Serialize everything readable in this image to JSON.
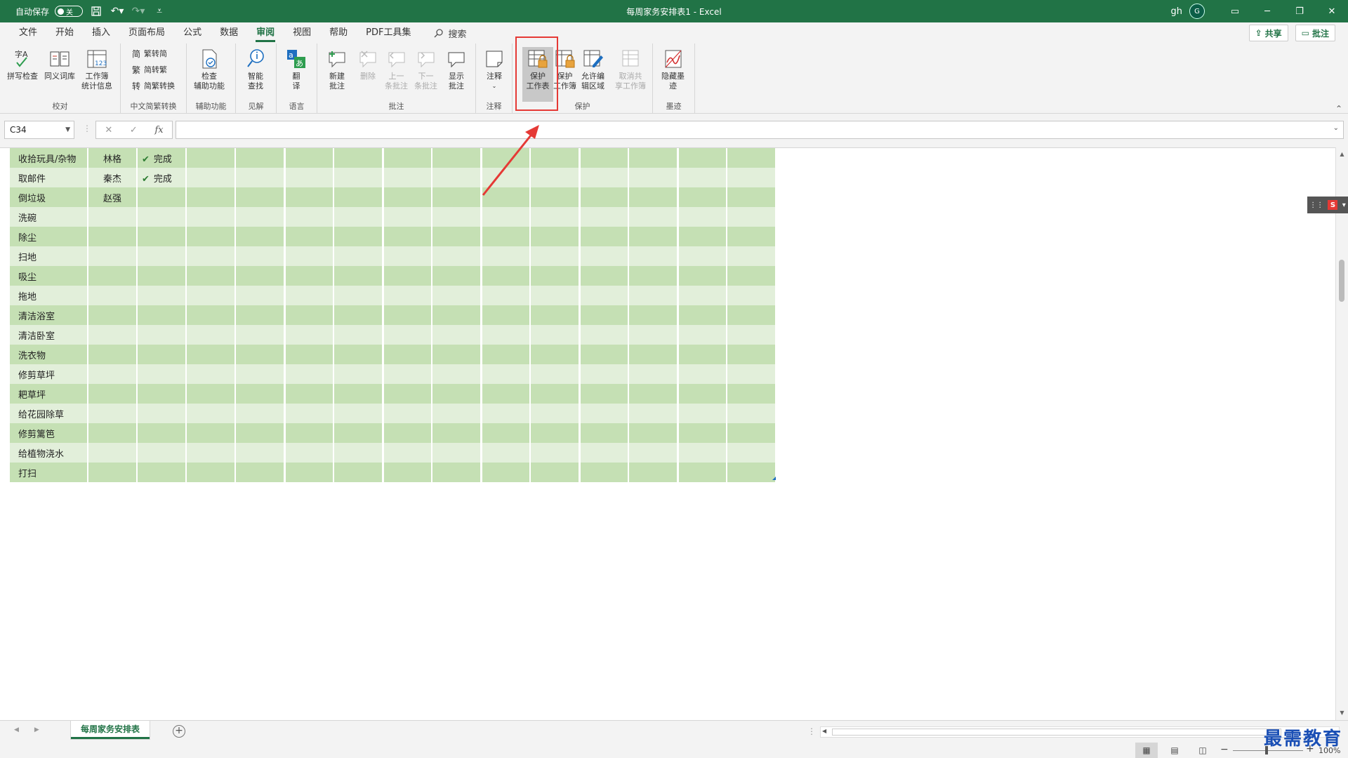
{
  "titlebar": {
    "autosave_label": "自动保存",
    "autosave_state": "关",
    "title": "每周家务安排表1  -  Excel",
    "user": "gh",
    "avatar_initial": "G"
  },
  "menu": {
    "items": [
      "文件",
      "开始",
      "插入",
      "页面布局",
      "公式",
      "数据",
      "审阅",
      "视图",
      "帮助",
      "PDF工具集"
    ],
    "active": "审阅",
    "search": "搜索",
    "share": "共享",
    "comments": "批注"
  },
  "ribbon": {
    "proofing": {
      "label": "校对",
      "spell": "拼写检查",
      "thesaurus": "同义词库",
      "stats_1": "工作簿",
      "stats_2": "统计信息"
    },
    "chinese": {
      "label": "中文简繁转换",
      "t2s": "繁转简",
      "s2t": "简转繁",
      "convert": "简繁转换"
    },
    "accessibility": {
      "label": "辅助功能",
      "check_1": "检查",
      "check_2": "辅助功能"
    },
    "insights": {
      "label": "见解",
      "smart_1": "智能",
      "smart_2": "查找"
    },
    "language": {
      "label": "语言",
      "translate_1": "翻",
      "translate_2": "译"
    },
    "comments": {
      "label": "批注",
      "new_1": "新建",
      "new_2": "批注",
      "delete": "删除",
      "prev_1": "上一",
      "prev_2": "条批注",
      "next_1": "下一",
      "next_2": "条批注",
      "show_1": "显示",
      "show_2": "批注"
    },
    "notes": {
      "label": "注释",
      "notes": "注释"
    },
    "protect": {
      "label": "保护",
      "sheet_1": "保护",
      "sheet_2": "工作表",
      "book_1": "保护",
      "book_2": "工作簿",
      "range_1": "允许编",
      "range_2": "辑区域",
      "unshare_1": "取消共",
      "unshare_2": "享工作簿"
    },
    "ink": {
      "label": "墨迹",
      "hide_1": "隐藏墨",
      "hide_2": "迹"
    }
  },
  "formula_bar": {
    "namebox": "C34",
    "cancel": "✕",
    "enter": "✓",
    "fx": "fx",
    "value": ""
  },
  "sheet": {
    "rows": [
      {
        "task": "收拾玩具/杂物",
        "person": "林格",
        "status": "完成"
      },
      {
        "task": "取邮件",
        "person": "秦杰",
        "status": "完成"
      },
      {
        "task": "倒垃圾",
        "person": "赵强",
        "status": ""
      },
      {
        "task": "洗碗",
        "person": "",
        "status": ""
      },
      {
        "task": "除尘",
        "person": "",
        "status": ""
      },
      {
        "task": "扫地",
        "person": "",
        "status": ""
      },
      {
        "task": "吸尘",
        "person": "",
        "status": ""
      },
      {
        "task": "拖地",
        "person": "",
        "status": ""
      },
      {
        "task": "清洁浴室",
        "person": "",
        "status": ""
      },
      {
        "task": "清洁卧室",
        "person": "",
        "status": ""
      },
      {
        "task": "洗衣物",
        "person": "",
        "status": ""
      },
      {
        "task": "修剪草坪",
        "person": "",
        "status": ""
      },
      {
        "task": "耙草坪",
        "person": "",
        "status": ""
      },
      {
        "task": "给花园除草",
        "person": "",
        "status": ""
      },
      {
        "task": "修剪篱笆",
        "person": "",
        "status": ""
      },
      {
        "task": "给植物浇水",
        "person": "",
        "status": ""
      },
      {
        "task": "打扫",
        "person": "",
        "status": ""
      }
    ]
  },
  "tabs": {
    "sheet_name": "每周家务安排表",
    "add": "+"
  },
  "status": {
    "zoom": "100%"
  },
  "watermark": "最需教育",
  "colors": {
    "accent": "#217346",
    "row_dark": "#c5e0b4",
    "row_light": "#e2efda",
    "highlight": "#e53935"
  }
}
